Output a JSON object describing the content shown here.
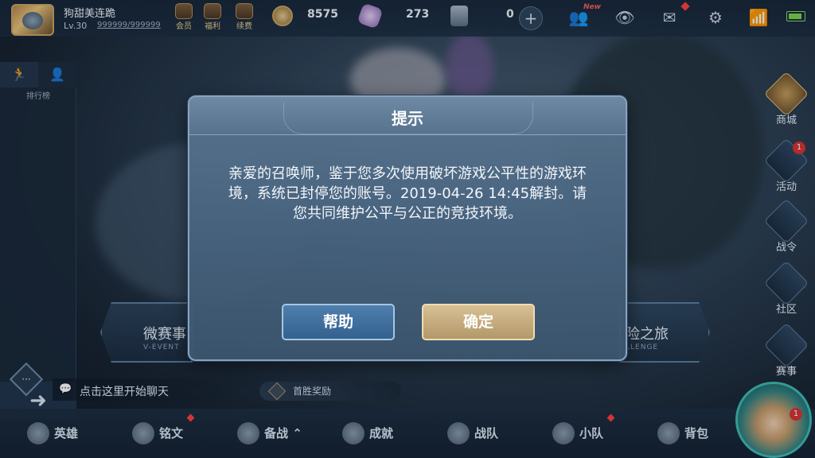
{
  "player": {
    "name": "狗甜美连跪",
    "level": "Lv.30",
    "exp": "999999/999999"
  },
  "top_icons": [
    {
      "name": "vip-icon",
      "label": "会员"
    },
    {
      "name": "welfare-icon",
      "label": "福利"
    },
    {
      "name": "renew-icon",
      "label": "续费"
    }
  ],
  "currency": {
    "gold": "8575",
    "diamond": "273",
    "coupon": "0"
  },
  "top_right": {
    "new_tag": "New"
  },
  "left_panel": {
    "rank_label": "排行榜"
  },
  "chat": {
    "placeholder": "点击这里开始聊天"
  },
  "first_win": "首胜奖励",
  "events": [
    {
      "title": "微赛事",
      "sub": "V-EVENT"
    },
    {
      "title": "险之旅",
      "sub": "LLENGE"
    }
  ],
  "side_menu": [
    {
      "label": "商城",
      "badge": ""
    },
    {
      "label": "活动",
      "badge": "1"
    },
    {
      "label": "战令",
      "badge": ""
    },
    {
      "label": "社区",
      "badge": ""
    },
    {
      "label": "赛事",
      "badge": ""
    }
  ],
  "bottom_nav": [
    "英雄",
    "铭文",
    "备战",
    "成就",
    "战队",
    "小队",
    "背包"
  ],
  "hero_badge": "1",
  "dialog": {
    "title": "提示",
    "message": "亲爱的召唤师，鉴于您多次使用破坏游戏公平性的游戏环境，系统已封停您的账号。2019-04-26 14:45解封。请您共同维护公平与公正的竞技环境。",
    "help_label": "帮助",
    "ok_label": "确定"
  },
  "colors": {
    "accent_gold": "#d8c096",
    "accent_blue": "#4f7fad",
    "badge_red": "#d93131"
  }
}
